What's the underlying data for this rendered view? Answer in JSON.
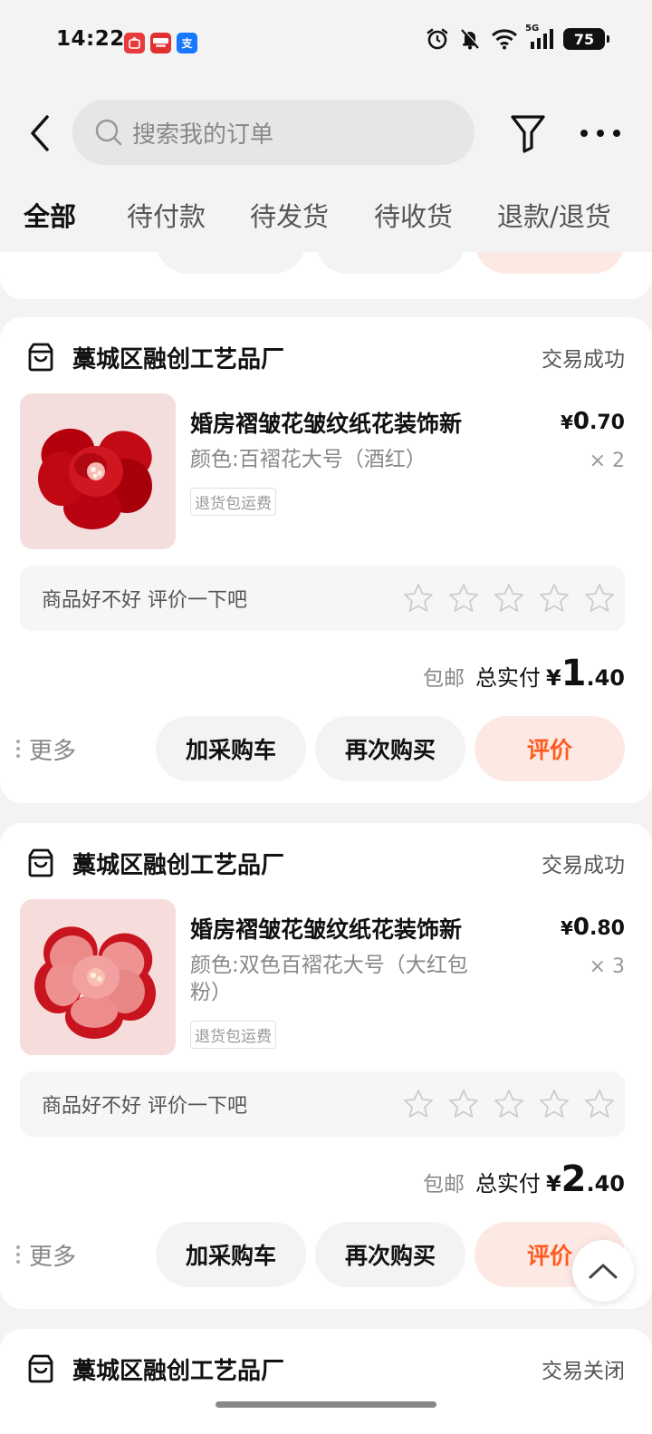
{
  "status_bar": {
    "time": "14:22",
    "network": "5G",
    "battery": "75",
    "app_badges": [
      {
        "icon": "app-badge-red-icon",
        "label": "",
        "color": "#e83a3a"
      },
      {
        "icon": "app-badge-red2-icon",
        "label": "",
        "color": "#e03030"
      },
      {
        "icon": "alipay-icon",
        "label": "支",
        "color": "#1677ff"
      }
    ]
  },
  "header": {
    "search_placeholder": "搜索我的订单"
  },
  "tabs": [
    "全部",
    "待付款",
    "待发货",
    "待收货",
    "退款/退货"
  ],
  "colors": {
    "accent": "#ff5a1f",
    "review_bg": "#fde9e3"
  },
  "orders": [
    {
      "shop": "藁城区融创工艺品厂",
      "status": "交易成功",
      "product_title": "婚房褶皱花皱纹纸花装饰新",
      "spec": "颜色:百褶花大号（酒红）",
      "tag": "退货包运费",
      "price_yen": "¥",
      "price_int": "0",
      "price_dec": ".70",
      "qty": "× 2",
      "review_prompt": "商品好不好 评价一下吧",
      "shipping": "包邮",
      "total_label": "总实付",
      "total_yen": "¥",
      "total_int": "1",
      "total_dec": ".40",
      "more": "更多",
      "btn_cart": "加采购车",
      "btn_rebuy": "再次购买",
      "btn_review": "评价"
    },
    {
      "shop": "藁城区融创工艺品厂",
      "status": "交易成功",
      "product_title": "婚房褶皱花皱纹纸花装饰新",
      "spec": "颜色:双色百褶花大号（大红包粉）",
      "tag": "退货包运费",
      "price_yen": "¥",
      "price_int": "0",
      "price_dec": ".80",
      "qty": "× 3",
      "review_prompt": "商品好不好 评价一下吧",
      "shipping": "包邮",
      "total_label": "总实付",
      "total_yen": "¥",
      "total_int": "2",
      "total_dec": ".40",
      "more": "更多",
      "btn_cart": "加采购车",
      "btn_rebuy": "再次购买",
      "btn_review": "评价"
    },
    {
      "shop": "藁城区融创工艺品厂",
      "status": "交易关闭"
    }
  ]
}
